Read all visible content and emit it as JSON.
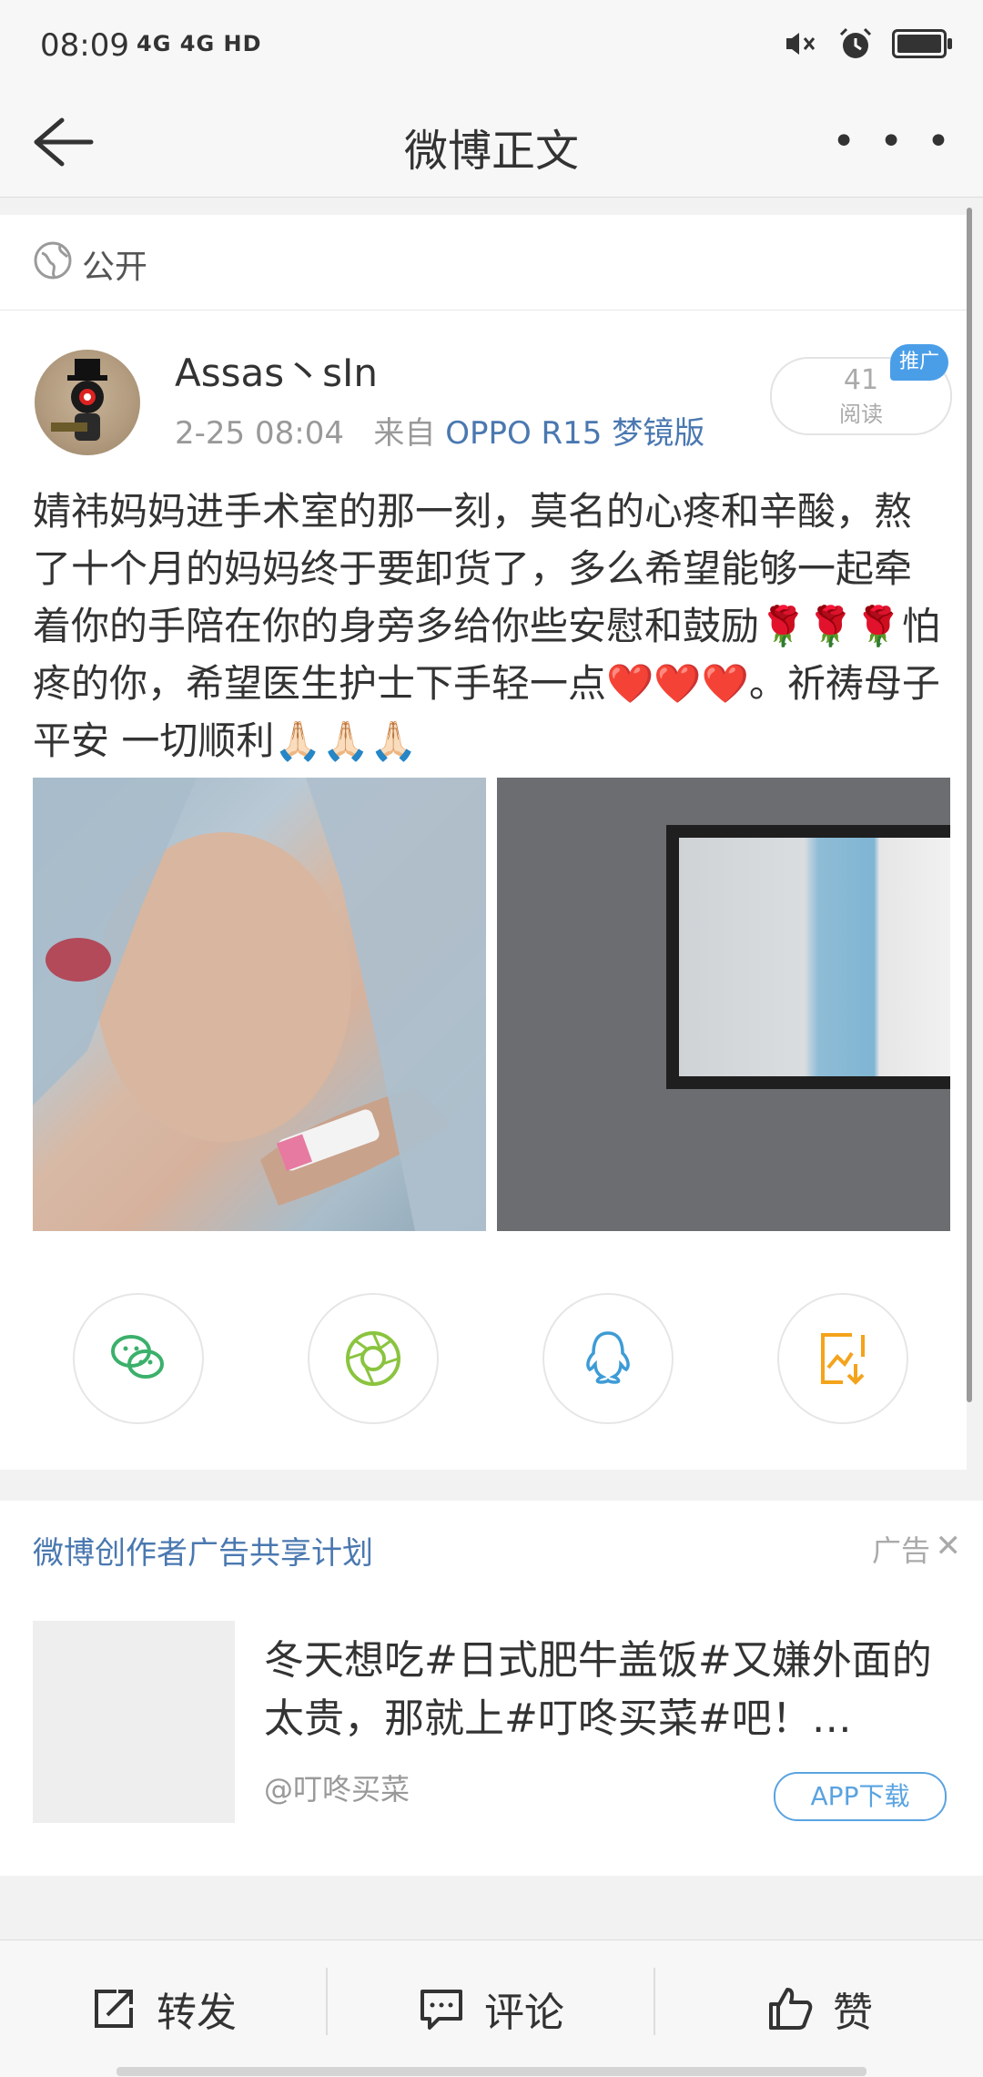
{
  "status_bar": {
    "time": "08:09",
    "network": "4G 4G HD"
  },
  "nav": {
    "title": "微博正文"
  },
  "post": {
    "visibility": "公开",
    "username": "Assas丶sIn",
    "time": "2-25 08:04",
    "source_prefix": "来自",
    "source": "OPPO R15 梦镜版",
    "reads_count": "41",
    "reads_label": "阅读",
    "promo_badge": "推广",
    "text": "婧祎妈妈进手术室的那一刻，莫名的心疼和辛酸，熬了十个月的妈妈终于要卸货了，多么希望能够一起牵着你的手陪在你的身旁多给你些安慰和鼓励🌹🌹🌹怕疼的你，希望医生护士下手轻一点❤️❤️❤️。祈祷母子平安 一切顺利🙏🏻🙏🏻🙏🏻",
    "share_icons": [
      "wechat-icon",
      "moments-icon",
      "qq-icon",
      "save-image-icon"
    ]
  },
  "ad": {
    "header": "微博创作者广告共享计划",
    "ad_label": "广告",
    "close": "✕",
    "description": "冬天想吃#日式肥牛盖饭#又嫌外面的太贵，那就上#叮咚买菜#吧！…",
    "handle": "@叮咚买菜",
    "download_label": "APP下载"
  },
  "bottom_bar": {
    "repost": "转发",
    "comment": "评论",
    "like": "赞"
  },
  "colors": {
    "link_blue": "#4a78b0",
    "promo_blue": "#4a9ee8",
    "wechat_green": "#3bb06b",
    "moments_green": "#8ac43f",
    "qq_blue": "#3e9bd6",
    "save_orange": "#f4a31c"
  }
}
